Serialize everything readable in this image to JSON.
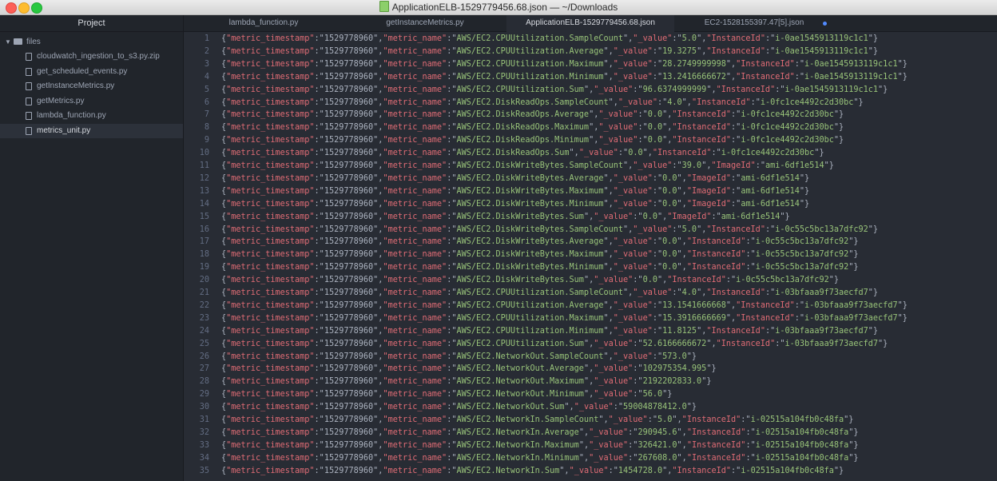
{
  "window": {
    "title": "ApplicationELB-1529779456.68.json — ~/Downloads"
  },
  "sidebar": {
    "header": "Project",
    "folder": "files",
    "files": [
      {
        "label": "cloudwatch_ingestion_to_s3.py.zip",
        "icon": "zip-file-icon"
      },
      {
        "label": "get_scheduled_events.py",
        "icon": "file-icon"
      },
      {
        "label": "getInstanceMetrics.py",
        "icon": "file-icon"
      },
      {
        "label": "getMetrics.py",
        "icon": "file-icon"
      },
      {
        "label": "lambda_function.py",
        "icon": "file-icon"
      },
      {
        "label": "metrics_unit.py",
        "icon": "file-icon"
      }
    ]
  },
  "tabs": [
    {
      "label": "lambda_function.py"
    },
    {
      "label": "getInstanceMetrics.py"
    },
    {
      "label": "ApplicationELB-1529779456.68.json",
      "active": true
    },
    {
      "label": "EC2-1528155397.47[5].json",
      "modified": true
    }
  ],
  "editor": {
    "lines": [
      {
        "n": "1",
        "ts": "1529778960",
        "name": "AWS/EC2.CPUUtilization.SampleCount",
        "value": "5.0",
        "idk": "InstanceId",
        "id": "i-0ae1545913119c1c1"
      },
      {
        "n": "2",
        "ts": "1529778960",
        "name": "AWS/EC2.CPUUtilization.Average",
        "value": "19.3275",
        "idk": "InstanceId",
        "id": "i-0ae1545913119c1c1"
      },
      {
        "n": "3",
        "ts": "1529778960",
        "name": "AWS/EC2.CPUUtilization.Maximum",
        "value": "28.2749999998",
        "idk": "InstanceId",
        "id": "i-0ae1545913119c1c1"
      },
      {
        "n": "4",
        "ts": "1529778960",
        "name": "AWS/EC2.CPUUtilization.Minimum",
        "value": "13.2416666672",
        "idk": "InstanceId",
        "id": "i-0ae1545913119c1c1"
      },
      {
        "n": "5",
        "ts": "1529778960",
        "name": "AWS/EC2.CPUUtilization.Sum",
        "value": "96.6374999999",
        "idk": "InstanceId",
        "id": "i-0ae1545913119c1c1"
      },
      {
        "n": "6",
        "ts": "1529778960",
        "name": "AWS/EC2.DiskReadOps.SampleCount",
        "value": "4.0",
        "idk": "InstanceId",
        "id": "i-0fc1ce4492c2d30bc"
      },
      {
        "n": "7",
        "ts": "1529778960",
        "name": "AWS/EC2.DiskReadOps.Average",
        "value": "0.0",
        "idk": "InstanceId",
        "id": "i-0fc1ce4492c2d30bc"
      },
      {
        "n": "8",
        "ts": "1529778960",
        "name": "AWS/EC2.DiskReadOps.Maximum",
        "value": "0.0",
        "idk": "InstanceId",
        "id": "i-0fc1ce4492c2d30bc"
      },
      {
        "n": "9",
        "ts": "1529778960",
        "name": "AWS/EC2.DiskReadOps.Minimum",
        "value": "0.0",
        "idk": "InstanceId",
        "id": "i-0fc1ce4492c2d30bc"
      },
      {
        "n": "10",
        "ts": "1529778960",
        "name": "AWS/EC2.DiskReadOps.Sum",
        "value": "0.0",
        "idk": "InstanceId",
        "id": "i-0fc1ce4492c2d30bc"
      },
      {
        "n": "11",
        "ts": "1529778960",
        "name": "AWS/EC2.DiskWriteBytes.SampleCount",
        "value": "39.0",
        "idk": "ImageId",
        "id": "ami-6df1e514"
      },
      {
        "n": "12",
        "ts": "1529778960",
        "name": "AWS/EC2.DiskWriteBytes.Average",
        "value": "0.0",
        "idk": "ImageId",
        "id": "ami-6df1e514"
      },
      {
        "n": "13",
        "ts": "1529778960",
        "name": "AWS/EC2.DiskWriteBytes.Maximum",
        "value": "0.0",
        "idk": "ImageId",
        "id": "ami-6df1e514"
      },
      {
        "n": "14",
        "ts": "1529778960",
        "name": "AWS/EC2.DiskWriteBytes.Minimum",
        "value": "0.0",
        "idk": "ImageId",
        "id": "ami-6df1e514"
      },
      {
        "n": "15",
        "ts": "1529778960",
        "name": "AWS/EC2.DiskWriteBytes.Sum",
        "value": "0.0",
        "idk": "ImageId",
        "id": "ami-6df1e514"
      },
      {
        "n": "16",
        "ts": "1529778960",
        "name": "AWS/EC2.DiskWriteBytes.SampleCount",
        "value": "5.0",
        "idk": "InstanceId",
        "id": "i-0c55c5bc13a7dfc92"
      },
      {
        "n": "17",
        "ts": "1529778960",
        "name": "AWS/EC2.DiskWriteBytes.Average",
        "value": "0.0",
        "idk": "InstanceId",
        "id": "i-0c55c5bc13a7dfc92"
      },
      {
        "n": "18",
        "ts": "1529778960",
        "name": "AWS/EC2.DiskWriteBytes.Maximum",
        "value": "0.0",
        "idk": "InstanceId",
        "id": "i-0c55c5bc13a7dfc92"
      },
      {
        "n": "19",
        "ts": "1529778960",
        "name": "AWS/EC2.DiskWriteBytes.Minimum",
        "value": "0.0",
        "idk": "InstanceId",
        "id": "i-0c55c5bc13a7dfc92"
      },
      {
        "n": "20",
        "ts": "1529778960",
        "name": "AWS/EC2.DiskWriteBytes.Sum",
        "value": "0.0",
        "idk": "InstanceId",
        "id": "i-0c55c5bc13a7dfc92"
      },
      {
        "n": "21",
        "ts": "1529778960",
        "name": "AWS/EC2.CPUUtilization.SampleCount",
        "value": "4.0",
        "idk": "InstanceId",
        "id": "i-03bfaaa9f73aecfd7"
      },
      {
        "n": "22",
        "ts": "1529778960",
        "name": "AWS/EC2.CPUUtilization.Average",
        "value": "13.1541666668",
        "idk": "InstanceId",
        "id": "i-03bfaaa9f73aecfd7"
      },
      {
        "n": "23",
        "ts": "1529778960",
        "name": "AWS/EC2.CPUUtilization.Maximum",
        "value": "15.3916666669",
        "idk": "InstanceId",
        "id": "i-03bfaaa9f73aecfd7"
      },
      {
        "n": "24",
        "ts": "1529778960",
        "name": "AWS/EC2.CPUUtilization.Minimum",
        "value": "11.8125",
        "idk": "InstanceId",
        "id": "i-03bfaaa9f73aecfd7"
      },
      {
        "n": "25",
        "ts": "1529778960",
        "name": "AWS/EC2.CPUUtilization.Sum",
        "value": "52.6166666672",
        "idk": "InstanceId",
        "id": "i-03bfaaa9f73aecfd7"
      },
      {
        "n": "26",
        "ts": "1529778960",
        "name": "AWS/EC2.NetworkOut.SampleCount",
        "value": "573.0"
      },
      {
        "n": "27",
        "ts": "1529778960",
        "name": "AWS/EC2.NetworkOut.Average",
        "value": "102975354.995"
      },
      {
        "n": "28",
        "ts": "1529778960",
        "name": "AWS/EC2.NetworkOut.Maximum",
        "value": "2192202833.0"
      },
      {
        "n": "29",
        "ts": "1529778960",
        "name": "AWS/EC2.NetworkOut.Minimum",
        "value": "56.0"
      },
      {
        "n": "30",
        "ts": "1529778960",
        "name": "AWS/EC2.NetworkOut.Sum",
        "value": "59004878412.0"
      },
      {
        "n": "31",
        "ts": "1529778960",
        "name": "AWS/EC2.NetworkIn.SampleCount",
        "value": "5.0",
        "idk": "InstanceId",
        "id": "i-02515a104fb0c48fa"
      },
      {
        "n": "32",
        "ts": "1529778960",
        "name": "AWS/EC2.NetworkIn.Average",
        "value": "290945.6",
        "idk": "InstanceId",
        "id": "i-02515a104fb0c48fa"
      },
      {
        "n": "33",
        "ts": "1529778960",
        "name": "AWS/EC2.NetworkIn.Maximum",
        "value": "326421.0",
        "idk": "InstanceId",
        "id": "i-02515a104fb0c48fa"
      },
      {
        "n": "34",
        "ts": "1529778960",
        "name": "AWS/EC2.NetworkIn.Minimum",
        "value": "267608.0",
        "idk": "InstanceId",
        "id": "i-02515a104fb0c48fa"
      },
      {
        "n": "35",
        "ts": "1529778960",
        "name": "AWS/EC2.NetworkIn.Sum",
        "value": "1454728.0",
        "idk": "InstanceId",
        "id": "i-02515a104fb0c48fa"
      }
    ]
  },
  "colors": {
    "key": "#e06c75",
    "string": "#98c379",
    "punct": "#abb2bf",
    "background": "#282c34",
    "sidebar": "#21252b"
  }
}
